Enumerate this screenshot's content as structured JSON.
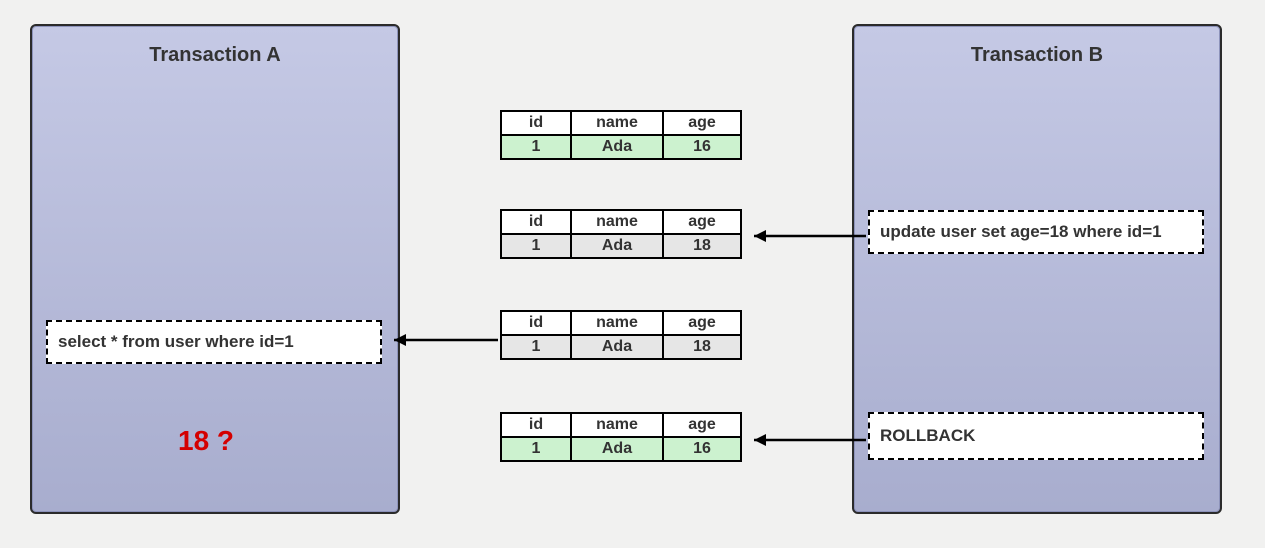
{
  "transactionA": {
    "title": "Transaction A",
    "query": "select * from user where id=1",
    "question": "18  ?"
  },
  "transactionB": {
    "title": "Transaction B",
    "update": "update user set age=18 where id=1",
    "rollback": "ROLLBACK"
  },
  "headers": {
    "id": "id",
    "name": "name",
    "age": "age"
  },
  "snapshots": [
    {
      "id": "1",
      "name": "Ada",
      "age": "16",
      "rowClass": "row-green"
    },
    {
      "id": "1",
      "name": "Ada",
      "age": "18",
      "rowClass": "row-grey"
    },
    {
      "id": "1",
      "name": "Ada",
      "age": "18",
      "rowClass": "row-grey"
    },
    {
      "id": "1",
      "name": "Ada",
      "age": "16",
      "rowClass": "row-green"
    }
  ]
}
